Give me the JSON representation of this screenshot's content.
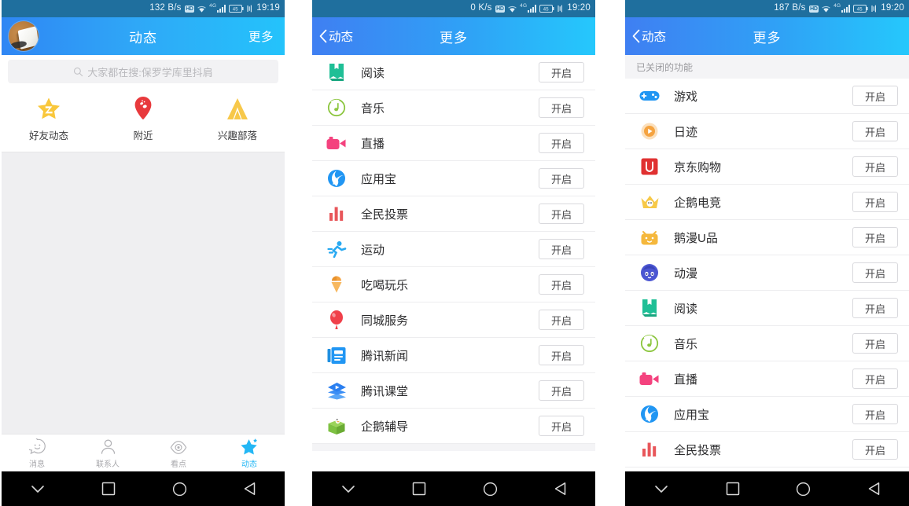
{
  "panels": [
    {
      "id": "feed-home",
      "status": {
        "netspeed": "132 B/s",
        "hd": "HD",
        "signal_gen": "4G",
        "battery": "45",
        "time": "19:19"
      },
      "header": {
        "title": "动态",
        "right": "更多"
      },
      "search": {
        "placeholder": "大家都在搜:保罗学库里抖肩",
        "icon": "search-icon"
      },
      "entries": [
        {
          "label": "好友动态",
          "icon": "star-qzone-icon",
          "color": "#f9c73b"
        },
        {
          "label": "附近",
          "icon": "location-pin-icon",
          "color": "#e8393c"
        },
        {
          "label": "兴趣部落",
          "icon": "tent-tribe-icon",
          "color": "#f7c84a"
        }
      ],
      "tabs": [
        {
          "label": "消息",
          "icon": "smiley-message-icon",
          "active": false
        },
        {
          "label": "联系人",
          "icon": "contacts-person-icon",
          "active": false
        },
        {
          "label": "看点",
          "icon": "eye-kandian-icon",
          "active": false
        },
        {
          "label": "动态",
          "icon": "star-dynamic-icon",
          "active": true
        }
      ]
    },
    {
      "id": "more-enabled",
      "status": {
        "netspeed": "0 K/s",
        "hd": "HD",
        "signal_gen": "4G",
        "battery": "45",
        "time": "19:20"
      },
      "header": {
        "back": "动态",
        "title": "更多",
        "back_icon": "chevron-left-icon"
      },
      "rows": [
        {
          "label": "阅读",
          "button": "开启",
          "icon": "book-read-icon",
          "color": "#1fbf96"
        },
        {
          "label": "音乐",
          "button": "开启",
          "icon": "music-note-icon",
          "color": "#8cc63f"
        },
        {
          "label": "直播",
          "button": "开启",
          "icon": "video-camera-icon",
          "color": "#f4427e"
        },
        {
          "label": "应用宝",
          "button": "开启",
          "icon": "myapp-swirl-icon",
          "color": "#2196f3"
        },
        {
          "label": "全民投票",
          "button": "开启",
          "icon": "bar-vote-icon",
          "color": "#e8565a"
        },
        {
          "label": "运动",
          "button": "开启",
          "icon": "runner-sport-icon",
          "color": "#29a9f1"
        },
        {
          "label": "吃喝玩乐",
          "button": "开启",
          "icon": "ice-cream-icon",
          "color": "#f5a340"
        },
        {
          "label": "同城服务",
          "button": "开启",
          "icon": "balloon-city-icon",
          "color": "#f0404a"
        },
        {
          "label": "腾讯新闻",
          "button": "开启",
          "icon": "news-paper-icon",
          "color": "#2196f3"
        },
        {
          "label": "腾讯课堂",
          "button": "开启",
          "icon": "class-play-icon",
          "color": "#2a7ff0"
        },
        {
          "label": "企鹅辅导",
          "button": "开启",
          "icon": "penguin-tutor-icon",
          "color": "#7ec142"
        }
      ]
    },
    {
      "id": "more-disabled",
      "status": {
        "netspeed": "187 B/s",
        "hd": "HD",
        "signal_gen": "4G",
        "battery": "45",
        "time": "19:20"
      },
      "header": {
        "back": "动态",
        "title": "更多",
        "back_icon": "chevron-left-icon"
      },
      "section_title": "已关闭的功能",
      "rows": [
        {
          "label": "游戏",
          "button": "开启",
          "icon": "gamepad-icon",
          "color": "#2196f3"
        },
        {
          "label": "日迹",
          "button": "开启",
          "icon": "day-track-icon",
          "color": "#f5a340"
        },
        {
          "label": "京东购物",
          "button": "开启",
          "icon": "jd-shopping-icon",
          "color": "#e03131"
        },
        {
          "label": "企鹅电竞",
          "button": "开启",
          "icon": "esports-crown-icon",
          "color": "#f7c948"
        },
        {
          "label": "鹅漫U品",
          "button": "开启",
          "icon": "goose-shop-icon",
          "color": "#f5b83d"
        },
        {
          "label": "动漫",
          "button": "开启",
          "icon": "anime-face-icon",
          "color": "#4b56d2"
        },
        {
          "label": "阅读",
          "button": "开启",
          "icon": "book-read-icon",
          "color": "#1fbf96"
        },
        {
          "label": "音乐",
          "button": "开启",
          "icon": "music-note-icon",
          "color": "#8cc63f"
        },
        {
          "label": "直播",
          "button": "开启",
          "icon": "video-camera-icon",
          "color": "#f4427e"
        },
        {
          "label": "应用宝",
          "button": "开启",
          "icon": "myapp-swirl-icon",
          "color": "#2196f3"
        },
        {
          "label": "全民投票",
          "button": "开启",
          "icon": "bar-vote-icon",
          "color": "#e8565a"
        }
      ]
    }
  ],
  "navbar": {
    "buttons": [
      "hide-keyboard-icon",
      "recents-square-icon",
      "home-circle-icon",
      "back-triangle-icon"
    ]
  },
  "colors": {
    "status_bar": "#1f6f9e",
    "header_left": "#2f86f4",
    "header_right": "#24c3fb",
    "accent": "#23b7f5",
    "feed_bg": "#efeff1"
  }
}
